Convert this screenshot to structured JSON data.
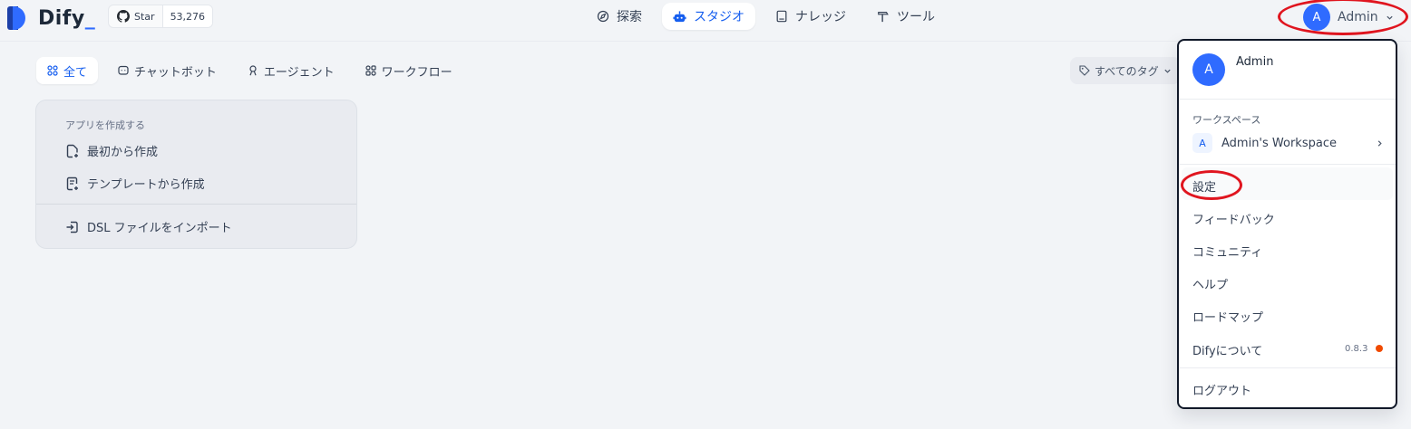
{
  "brand": {
    "name": "Dify",
    "underscore": "_"
  },
  "github": {
    "label": "Star",
    "count": "53,276"
  },
  "nav": {
    "items": [
      {
        "label": "探索",
        "icon": "compass-icon"
      },
      {
        "label": "スタジオ",
        "icon": "robot-icon"
      },
      {
        "label": "ナレッジ",
        "icon": "book-icon"
      },
      {
        "label": "ツール",
        "icon": "hammer-icon"
      }
    ],
    "active_index": 1
  },
  "user": {
    "name": "Admin",
    "initial": "A"
  },
  "tabs": [
    {
      "label": "全て",
      "icon": "grid-icon"
    },
    {
      "label": "チャットボット",
      "icon": "chat-icon"
    },
    {
      "label": "エージェント",
      "icon": "agent-icon"
    },
    {
      "label": "ワークフロー",
      "icon": "workflow-icon"
    }
  ],
  "tag_filter": {
    "label": "すべてのタグ"
  },
  "create_card": {
    "title": "アプリを作成する",
    "blank": "最初から作成",
    "template": "テンプレートから作成",
    "import": "DSL ファイルをインポート"
  },
  "dropdown": {
    "username": "Admin",
    "workspace_label": "ワークスペース",
    "workspace_name": "Admin's Workspace",
    "workspace_initial": "A",
    "settings": "設定",
    "feedback": "フィードバック",
    "community": "コミュニティ",
    "help": "ヘルプ",
    "roadmap": "ロードマップ",
    "about": "Difyについて",
    "version": "0.8.3",
    "logout": "ログアウト"
  },
  "colors": {
    "accent": "#155eef",
    "avatar": "#2f6bff",
    "annotation": "#e0151f",
    "version_dot": "#f04a00"
  }
}
